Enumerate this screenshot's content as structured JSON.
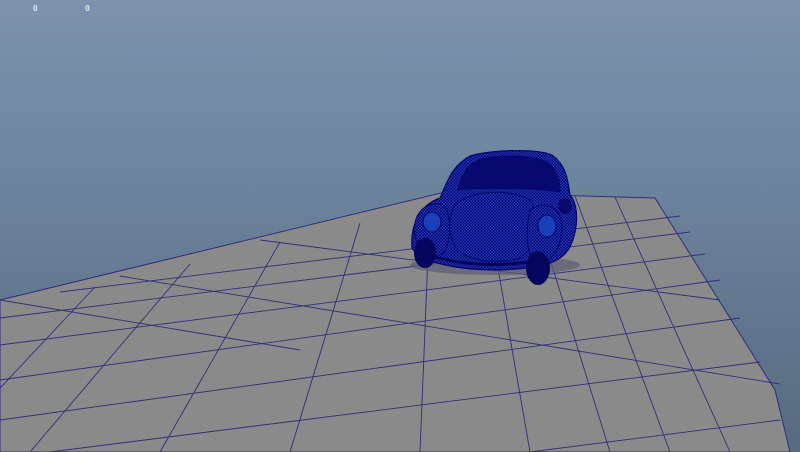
{
  "hud": {
    "value_a": "0",
    "value_b": "0"
  },
  "colors": {
    "background_top": "#7d93ac",
    "background_bottom": "#576a7f",
    "ground": "#8a8a8a",
    "grid_lines": "#2f2f7a",
    "model_wireframe": "#0a0a80"
  },
  "scene": {
    "object": "car-wireframe-model"
  }
}
